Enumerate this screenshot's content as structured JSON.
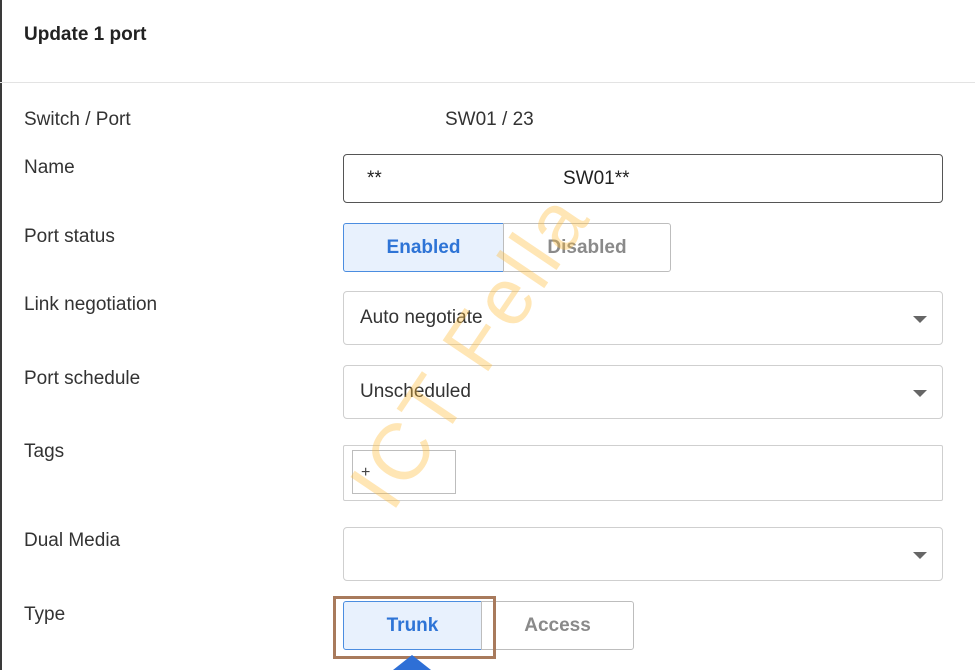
{
  "header": {
    "title": "Update 1 port"
  },
  "form": {
    "switch_port": {
      "label": "Switch / Port",
      "value": "SW01 / 23"
    },
    "name": {
      "label": "Name",
      "value_prefix": "**",
      "value": "SW01**"
    },
    "port_status": {
      "label": "Port status",
      "options": [
        "Enabled",
        "Disabled"
      ],
      "selected": "Enabled"
    },
    "link_negotiation": {
      "label": "Link negotiation",
      "value": "Auto negotiate"
    },
    "port_schedule": {
      "label": "Port schedule",
      "value": "Unscheduled"
    },
    "tags": {
      "label": "Tags",
      "add_label": "+"
    },
    "dual_media": {
      "label": "Dual Media",
      "value": ""
    },
    "type": {
      "label": "Type",
      "options": [
        "Trunk",
        "Access"
      ],
      "selected": "Trunk"
    }
  },
  "watermark": {
    "text": "ICT Fella"
  },
  "colors": {
    "accent": "#2e74d6",
    "active_bg": "#e8f1fd",
    "highlight": "#a87a5c",
    "watermark": "#ffbe3c"
  }
}
